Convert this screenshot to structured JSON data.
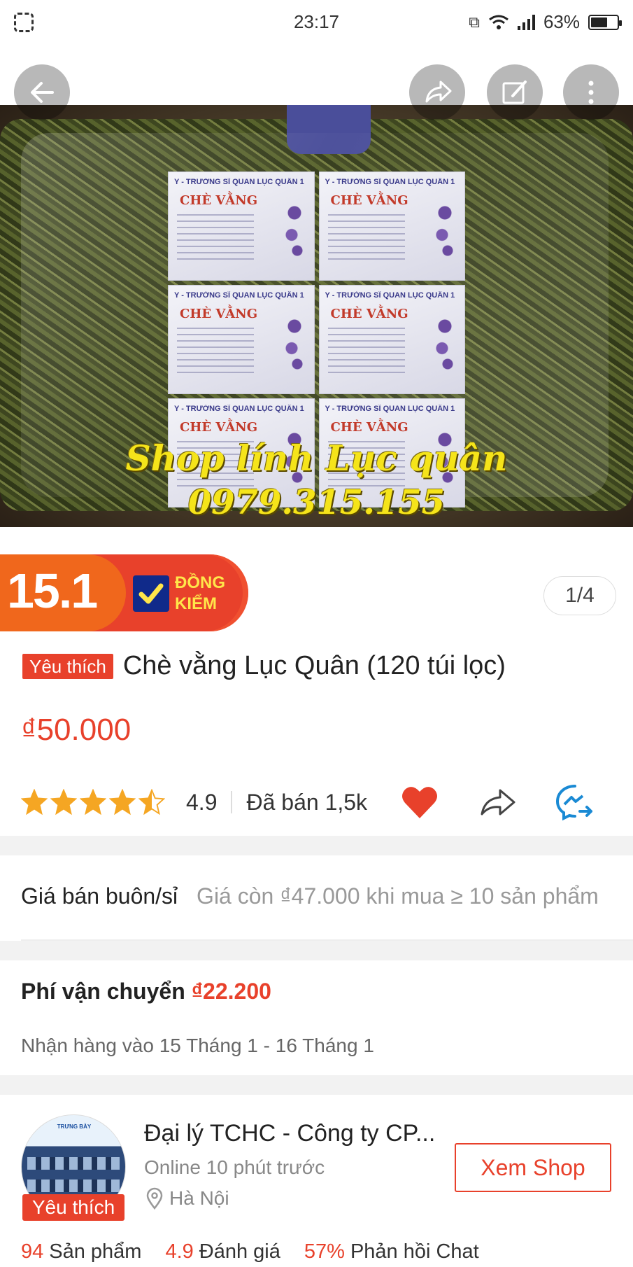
{
  "status_bar": {
    "time": "23:17",
    "battery": "63%",
    "battery_level": 0.63
  },
  "hero": {
    "watermark_line1": "Shop lính Lục quân",
    "watermark_line2": "0979.315.155",
    "packet_header": "Y - TRƯỜNG SĨ QUAN LỤC QUÂN 1",
    "packet_title": "CHÈ VẰNG"
  },
  "badge": {
    "number": "15.1",
    "label_line1": "ĐỒNG",
    "label_line2": "KIỂM"
  },
  "image_counter": "1/4",
  "product": {
    "fav_tag": "Yêu thích",
    "title": "Chè vằng Lục Quân (120 túi lọc)",
    "price": "₫50.000",
    "rating": "4.9",
    "rating_value": 4.5,
    "sold": "Đã bán 1,5k"
  },
  "wholesale": {
    "label": "Giá bán buôn/sỉ",
    "value": "Giá còn ₫47.000 khi mua ≥ 10 sản phẩm"
  },
  "shipping": {
    "label": "Phí vận chuyển",
    "fee": "₫22.200",
    "delivery": "Nhận hàng vào 15 Tháng 1 - 16 Tháng 1"
  },
  "shop": {
    "name": "Đại lý TCHC - Công ty CP...",
    "online": "Online 10 phút trước",
    "location": "Hà Nội",
    "fav_tag": "Yêu thích",
    "view_button": "Xem Shop",
    "stats": [
      {
        "num": "94",
        "label": "Sản phẩm"
      },
      {
        "num": "4.9",
        "label": "Đánh giá"
      },
      {
        "num": "57%",
        "label": "Phản hồi Chat"
      }
    ]
  },
  "colors": {
    "accent": "#e8412b",
    "star": "#f5a623",
    "messenger": "#1a8ad4"
  },
  "icons": [
    "back-arrow-icon",
    "share-icon",
    "edit-icon",
    "more-vertical-icon",
    "heart-icon",
    "share-arrow-icon",
    "messenger-share-icon",
    "location-pin-icon",
    "check-icon"
  ]
}
